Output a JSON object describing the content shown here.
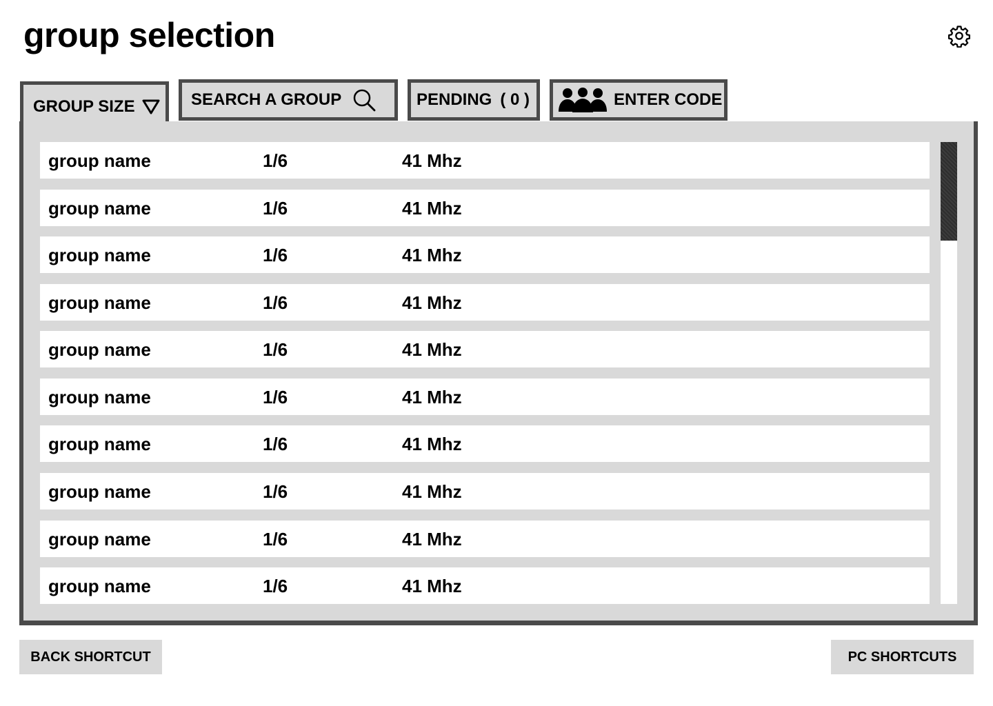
{
  "header": {
    "title": "group selection",
    "settings_icon": "gear-icon"
  },
  "tabs": {
    "group_size": {
      "label": "GROUP SIZE",
      "icon": "triangle-down-icon"
    },
    "search": {
      "label": "SEARCH A GROUP",
      "icon": "search-icon"
    },
    "pending": {
      "label": "PENDING",
      "count": "( 0 )"
    },
    "enter_code": {
      "label": "ENTER CODE",
      "icon": "group-people-icon"
    }
  },
  "groups": [
    {
      "name": "group name",
      "size": "1/6",
      "frequency": "41 Mhz"
    },
    {
      "name": "group name",
      "size": "1/6",
      "frequency": "41 Mhz"
    },
    {
      "name": "group name",
      "size": "1/6",
      "frequency": "41 Mhz"
    },
    {
      "name": "group name",
      "size": "1/6",
      "frequency": "41 Mhz"
    },
    {
      "name": "group name",
      "size": "1/6",
      "frequency": "41 Mhz"
    },
    {
      "name": "group name",
      "size": "1/6",
      "frequency": "41 Mhz"
    },
    {
      "name": "group name",
      "size": "1/6",
      "frequency": "41 Mhz"
    },
    {
      "name": "group name",
      "size": "1/6",
      "frequency": "41 Mhz"
    },
    {
      "name": "group name",
      "size": "1/6",
      "frequency": "41 Mhz"
    },
    {
      "name": "group name",
      "size": "1/6",
      "frequency": "41 Mhz"
    }
  ],
  "footer": {
    "back_label": "BACK SHORTCUT",
    "pc_label": "PC SHORTCUTS"
  },
  "colors": {
    "panel_bg": "#d9d9d9",
    "border": "#4a4a4a",
    "row_bg": "#ffffff"
  }
}
